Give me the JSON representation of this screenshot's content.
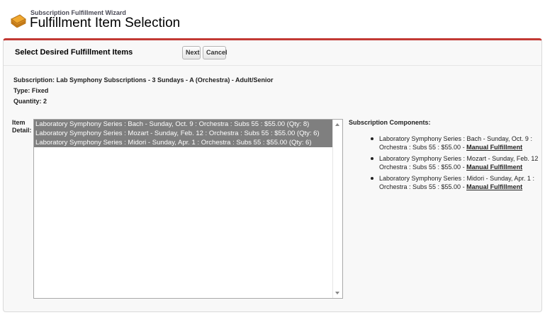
{
  "header": {
    "wizard_label": "Subscription Fulfillment Wizard",
    "title": "Fulfillment Item Selection"
  },
  "panel": {
    "title": "Select Desired Fulfillment Items",
    "next_label": "Next",
    "cancel_label": "Cancel",
    "accent_color": "#c23934"
  },
  "info": {
    "subscription": "Subscription: Lab Symphony Subscriptions - 3 Sundays - A (Orchestra) - Adult/Senior",
    "type": "Type: Fixed",
    "quantity": "Quantity: 2"
  },
  "item_detail": {
    "label": "Item Detail:",
    "options": [
      "Laboratory Symphony Series : Bach - Sunday, Oct. 9 : Orchestra : Subs 55 : $55.00 (Qty: 8)",
      "Laboratory Symphony Series : Mozart - Sunday, Feb. 12 : Orchestra : Subs 55 : $55.00 (Qty: 6)",
      "Laboratory Symphony Series : Midori - Sunday, Apr. 1 : Orchestra : Subs 55 : $55.00 (Qty: 6)"
    ]
  },
  "components": {
    "title": "Subscription Components:",
    "items": [
      {
        "text": "Laboratory Symphony Series : Bach - Sunday, Oct. 9 : Orchestra : Subs 55 : $55.00 - ",
        "link": "Manual Fulfillment"
      },
      {
        "text": "Laboratory Symphony Series : Mozart - Sunday, Feb. 12 Orchestra : Subs 55 : $55.00 - ",
        "link": "Manual Fulfillment"
      },
      {
        "text": "Laboratory Symphony Series : Midori - Sunday, Apr. 1 : Orchestra : Subs 55 : $55.00 - ",
        "link": "Manual Fulfillment"
      }
    ]
  }
}
